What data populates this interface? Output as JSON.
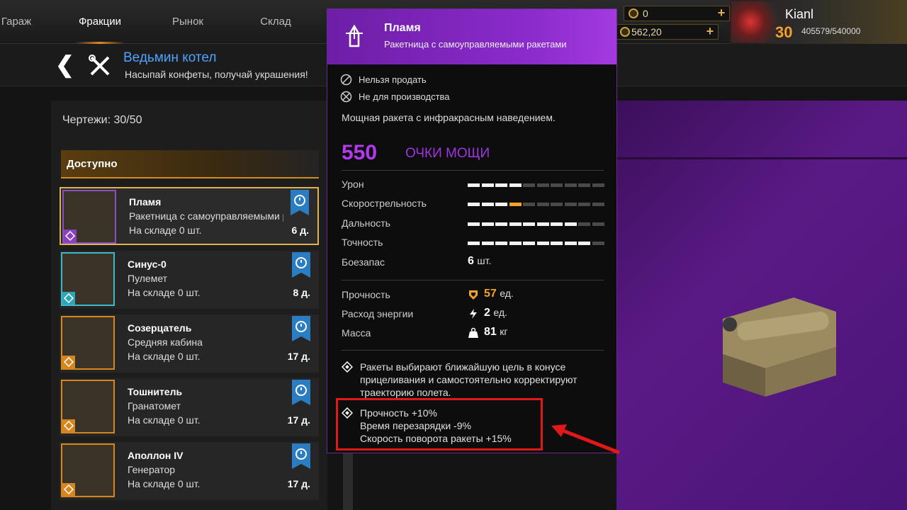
{
  "nav": {
    "tabs": [
      {
        "label": "Гараж"
      },
      {
        "label": "Фракции"
      },
      {
        "label": "Рынок"
      },
      {
        "label": "Склад"
      }
    ]
  },
  "resources": {
    "coins": "0",
    "currency": "562,20"
  },
  "profile": {
    "name": "Kianl",
    "level": "30",
    "xp": "405579/540000"
  },
  "header": {
    "title": "Ведьмин котел",
    "subtitle": "Насыпай конфеты, получай украшения!"
  },
  "blueprints": {
    "label": "Чертежи: 30/50"
  },
  "section": {
    "label": "Доступно"
  },
  "items": [
    {
      "name": "Пламя",
      "type": "Ракетница с самоуправляемыми ракетами",
      "stock": "На складе 0 шт.",
      "days": "6 д."
    },
    {
      "name": "Синус-0",
      "type": "Пулемет",
      "stock": "На складе 0 шт.",
      "days": "8 д."
    },
    {
      "name": "Созерцатель",
      "type": "Средняя кабина",
      "stock": "На складе 0 шт.",
      "days": "17 д."
    },
    {
      "name": "Тошнитель",
      "type": "Гранатомет",
      "stock": "На складе 0 шт.",
      "days": "17 д."
    },
    {
      "name": "Аполлон IV",
      "type": "Генератор",
      "stock": "На складе 0 шт.",
      "days": "17 д."
    }
  ],
  "tooltip": {
    "name": "Пламя",
    "subtitle": "Ракетница с самоуправляемыми ракетами",
    "flag_1": "Нельзя продать",
    "flag_2": "Не для производства",
    "description": "Мощная ракета с инфракрасным наведением.",
    "power": "550",
    "power_label": "ОЧКИ МОЩИ",
    "stats": [
      {
        "label": "Урон",
        "level": 4,
        "highlight": 0
      },
      {
        "label": "Скорострельность",
        "level": 3,
        "highlight": 1
      },
      {
        "label": "Дальность",
        "level": 8,
        "highlight": 0
      },
      {
        "label": "Точность",
        "level": 9,
        "highlight": 0
      }
    ],
    "ammo_label": "Боезапас",
    "ammo_value": "6",
    "ammo_unit": "шт.",
    "durability_label": "Прочность",
    "durability_value": "57",
    "durability_unit": "ед.",
    "energy_label": "Расход энергии",
    "energy_value": "2",
    "energy_unit": "ед.",
    "mass_label": "Масса",
    "mass_value": "81",
    "mass_unit": "кг",
    "perk_1": [
      "Ракеты выбирают ближайшую цель в конусе",
      "прицеливания и самостоятельно корректируют",
      "траекторию полета."
    ],
    "perk_2": [
      "Прочность +10%",
      "Время перезарядки -9%",
      "Скорость поворота ракеты +15%"
    ]
  }
}
